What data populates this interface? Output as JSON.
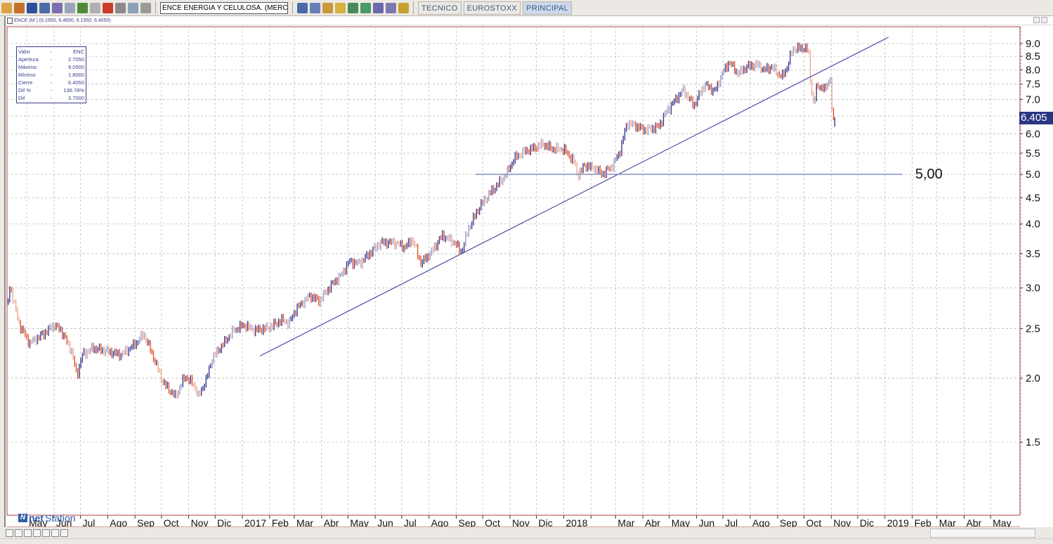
{
  "toolbar": {
    "icons": [
      "open-icon",
      "edit-icon",
      "save-icon",
      "print-icon",
      "print-preview-icon",
      "copy-icon",
      "tree-icon",
      "eraser-icon",
      "color-wheel-icon",
      "text-icon",
      "settings-icon",
      "disabled-icon"
    ],
    "symbol_value": "ENCE ENERGIA Y CELULOSA. (MERCADO CI",
    "icons2": [
      "grid-icon",
      "calendar-icon",
      "pencil-icon",
      "chart-bar-icon",
      "chart-line-icon",
      "chart-compare-icon",
      "note-icon",
      "scan-icon",
      "help-icon"
    ],
    "tabs": [
      {
        "label": "TECNICO",
        "active": false
      },
      {
        "label": "EUROSTOXX",
        "active": false
      },
      {
        "label": "PRINCIPAL",
        "active": true
      }
    ]
  },
  "window": {
    "title": "ENCE (M ) (6.1950, 6.4650, 6.1950, 6.4050)"
  },
  "info_box": {
    "rows": [
      {
        "k": "Valor",
        "v": "ENC"
      },
      {
        "k": "Apertura",
        "v": "2.7050"
      },
      {
        "k": "Máximo",
        "v": "9.0500"
      },
      {
        "k": "Mínimo",
        "v": "1.8000"
      },
      {
        "k": "Cierre",
        "v": "6.4050"
      },
      {
        "k": "Dif %",
        "v": "136.78%"
      },
      {
        "k": "Dif",
        "v": "3.7000"
      }
    ],
    "dash": "-"
  },
  "logo": {
    "pre": "net",
    "post": "Station"
  },
  "last_price_tag": "6.405",
  "colors": {
    "up": "#2b2f8c",
    "down": "#e04a1a",
    "frame": "#b04040",
    "trendline": "#3a3f9a",
    "support": "#8e97c4",
    "grid": "#bbbbbb"
  },
  "chart_data": {
    "type": "ohlc",
    "symbol": "ENCE",
    "yscale": "log",
    "ylim": [
      1.08,
      9.7
    ],
    "grid": true,
    "y_ticks": [
      "9.0",
      "8.5",
      "8.0",
      "7.5",
      "7.0",
      "6.5",
      "6.0",
      "5.5",
      "5.0",
      "4.5",
      "4.0",
      "3.5",
      "3.0",
      "2.5",
      "2.0",
      "1.5"
    ],
    "x_start_month": "2016-05",
    "x_labels": [
      "May",
      "Jun",
      "Jul",
      "Ago",
      "Sep",
      "Oct",
      "Nov",
      "Dic",
      "2017",
      "Feb",
      "Mar",
      "Abr",
      "May",
      "Jun",
      "Jul",
      "Ago",
      "Sep",
      "Oct",
      "Nov",
      "Dic",
      "2018",
      "",
      "Mar",
      "Abr",
      "May",
      "Jun",
      "Jul",
      "Ago",
      "Sep",
      "Oct",
      "Nov",
      "Dic",
      "2019",
      "Feb",
      "Mar",
      "Abr",
      "May"
    ],
    "closes": [
      [
        "2016-04-10",
        2.81
      ],
      [
        "2016-04-12",
        3.04
      ],
      [
        "2016-04-22",
        2.56
      ],
      [
        "2016-05-04",
        2.34
      ],
      [
        "2016-05-20",
        2.44
      ],
      [
        "2016-06-01",
        2.54
      ],
      [
        "2016-06-09",
        2.48
      ],
      [
        "2016-06-21",
        2.26
      ],
      [
        "2016-06-27",
        2.02
      ],
      [
        "2016-07-03",
        2.22
      ],
      [
        "2016-07-15",
        2.29
      ],
      [
        "2016-07-31",
        2.26
      ],
      [
        "2016-08-16",
        2.22
      ],
      [
        "2016-09-01",
        2.33
      ],
      [
        "2016-09-11",
        2.44
      ],
      [
        "2016-09-21",
        2.22
      ],
      [
        "2016-10-03",
        1.96
      ],
      [
        "2016-10-17",
        1.84
      ],
      [
        "2016-10-28",
        2.02
      ],
      [
        "2016-11-08",
        1.93
      ],
      [
        "2016-11-12",
        1.84
      ],
      [
        "2016-11-21",
        1.99
      ],
      [
        "2016-11-28",
        2.19
      ],
      [
        "2016-12-10",
        2.33
      ],
      [
        "2016-12-22",
        2.48
      ],
      [
        "2017-01-03",
        2.54
      ],
      [
        "2017-01-15",
        2.48
      ],
      [
        "2017-01-31",
        2.51
      ],
      [
        "2017-02-15",
        2.6
      ],
      [
        "2017-02-23",
        2.56
      ],
      [
        "2017-03-03",
        2.73
      ],
      [
        "2017-03-19",
        2.9
      ],
      [
        "2017-03-29",
        2.83
      ],
      [
        "2017-04-12",
        3.04
      ],
      [
        "2017-04-24",
        3.19
      ],
      [
        "2017-05-02",
        3.38
      ],
      [
        "2017-05-14",
        3.35
      ],
      [
        "2017-05-26",
        3.51
      ],
      [
        "2017-06-07",
        3.68
      ],
      [
        "2017-06-23",
        3.68
      ],
      [
        "2017-07-05",
        3.6
      ],
      [
        "2017-07-13",
        3.74
      ],
      [
        "2017-07-23",
        3.35
      ],
      [
        "2017-08-04",
        3.53
      ],
      [
        "2017-08-16",
        3.8
      ],
      [
        "2017-08-30",
        3.68
      ],
      [
        "2017-09-07",
        3.53
      ],
      [
        "2017-09-15",
        3.92
      ],
      [
        "2017-09-27",
        4.31
      ],
      [
        "2017-10-09",
        4.59
      ],
      [
        "2017-10-21",
        4.84
      ],
      [
        "2017-10-29",
        5.05
      ],
      [
        "2017-11-06",
        5.38
      ],
      [
        "2017-11-18",
        5.55
      ],
      [
        "2017-11-30",
        5.64
      ],
      [
        "2017-12-08",
        5.73
      ],
      [
        "2017-12-20",
        5.6
      ],
      [
        "2018-01-01",
        5.6
      ],
      [
        "2018-01-13",
        5.29
      ],
      [
        "2018-01-17",
        4.97
      ],
      [
        "2018-01-25",
        5.21
      ],
      [
        "2018-02-06",
        5.13
      ],
      [
        "2018-02-14",
        5.0
      ],
      [
        "2018-02-26",
        5.21
      ],
      [
        "2018-03-06",
        5.55
      ],
      [
        "2018-03-14",
        6.3
      ],
      [
        "2018-03-22",
        6.24
      ],
      [
        "2018-04-03",
        6.1
      ],
      [
        "2018-04-19",
        6.2
      ],
      [
        "2018-04-27",
        6.6
      ],
      [
        "2018-05-09",
        7.03
      ],
      [
        "2018-05-17",
        7.31
      ],
      [
        "2018-05-29",
        6.81
      ],
      [
        "2018-06-10",
        7.49
      ],
      [
        "2018-06-22",
        7.26
      ],
      [
        "2018-06-30",
        7.86
      ],
      [
        "2018-07-08",
        8.29
      ],
      [
        "2018-07-18",
        7.86
      ],
      [
        "2018-07-28",
        8.11
      ],
      [
        "2018-08-09",
        8.19
      ],
      [
        "2018-08-17",
        7.98
      ],
      [
        "2018-08-25",
        8.11
      ],
      [
        "2018-09-06",
        7.73
      ],
      [
        "2018-09-12",
        8.11
      ],
      [
        "2018-09-18",
        8.77
      ],
      [
        "2018-09-30",
        8.83
      ],
      [
        "2018-10-06",
        8.77
      ],
      [
        "2018-10-08",
        7.73
      ],
      [
        "2018-10-12",
        6.81
      ],
      [
        "2018-10-16",
        7.49
      ],
      [
        "2018-10-24",
        7.31
      ],
      [
        "2018-10-31",
        7.73
      ],
      [
        "2018-11-01",
        6.6
      ],
      [
        "2018-11-05",
        6.405
      ]
    ],
    "trendline": {
      "from": [
        "2017-01-21",
        2.21
      ],
      "to": [
        "2019-01-05",
        9.26
      ]
    },
    "support_line": {
      "value": 5.0,
      "from": "2017-09-23",
      "to": "2019-01-21",
      "label": "5,00"
    }
  },
  "bottombar": {
    "icons": [
      "zoom-reset-icon",
      "ec-icon",
      "spacing-icon",
      "fit-icon",
      "zoom-out-icon",
      "zoom-in-icon",
      "scroll-left-icon"
    ]
  }
}
